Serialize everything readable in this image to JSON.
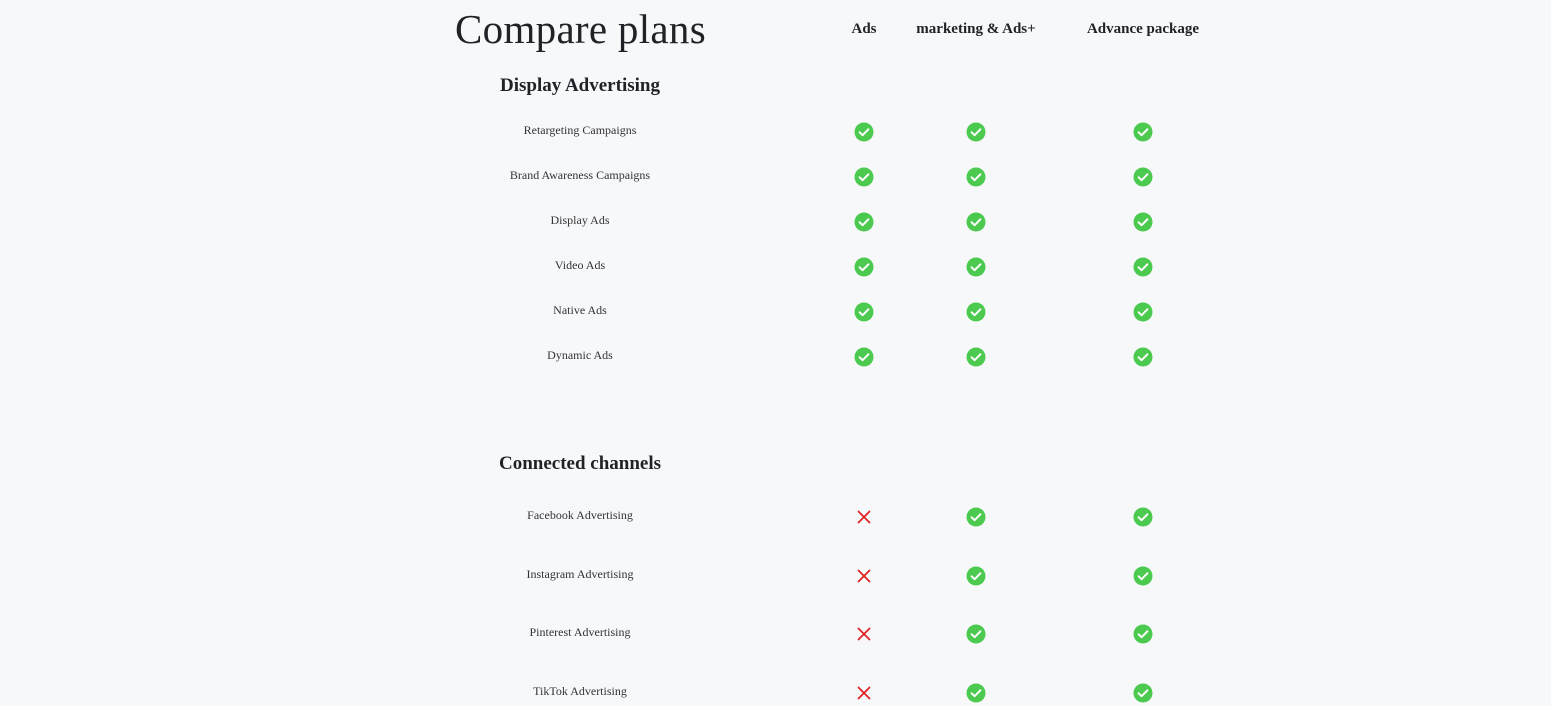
{
  "page_title": "Compare plans",
  "plans": [
    "Ads",
    "marketing & Ads+",
    "Advance package"
  ],
  "sections": [
    {
      "title": "Display Advertising",
      "features": [
        {
          "name": "Retargeting Campaigns",
          "values": [
            true,
            true,
            true
          ]
        },
        {
          "name": "Brand Awareness Campaigns",
          "values": [
            true,
            true,
            true
          ]
        },
        {
          "name": "Display Ads",
          "values": [
            true,
            true,
            true
          ]
        },
        {
          "name": "Video Ads",
          "values": [
            true,
            true,
            true
          ]
        },
        {
          "name": "Native Ads",
          "values": [
            true,
            true,
            true
          ]
        },
        {
          "name": "Dynamic Ads",
          "values": [
            true,
            true,
            true
          ]
        }
      ]
    },
    {
      "title": "Connected channels",
      "features": [
        {
          "name": "Facebook Advertising",
          "values": [
            false,
            true,
            true
          ]
        },
        {
          "name": "Instagram Advertising",
          "values": [
            false,
            true,
            true
          ]
        },
        {
          "name": "Pinterest Advertising",
          "values": [
            false,
            true,
            true
          ]
        },
        {
          "name": "TikTok Advertising",
          "values": [
            false,
            true,
            true
          ]
        }
      ]
    }
  ],
  "colors": {
    "check": "#4cc94f",
    "cross": "#e02424"
  },
  "icons": {
    "included": "check-circle-icon",
    "excluded": "cross-icon"
  }
}
